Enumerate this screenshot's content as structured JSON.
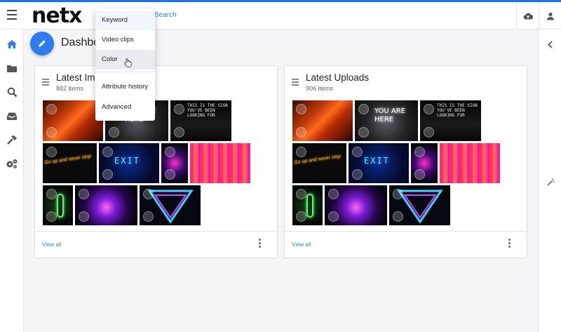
{
  "app": {
    "logo": "netx",
    "search_link": "Search"
  },
  "page": {
    "title": "Dashboard"
  },
  "menu": {
    "items": [
      "Keyword",
      "Video clips",
      "Color",
      "Attribute history",
      "Advanced"
    ],
    "hovered": "Color"
  },
  "cards": [
    {
      "title": "Latest Images",
      "count": "882 items",
      "view_all": "View all"
    },
    {
      "title": "Latest Uploads",
      "count": "906 items",
      "view_all": "View all"
    }
  ],
  "thumbs": {
    "are_here_text": "YOU ARE HERE",
    "sign_text": "THIS IS THE SIGN YOU'VE BEEN LOOKING FOR",
    "goup_text": "Go up and never stop",
    "exit_text": "EXIT"
  },
  "icons": {
    "menu": "hamburger-icon",
    "upload": "cloud-upload-icon",
    "user": "user-icon",
    "home": "home-icon",
    "folder": "folder-icon",
    "search": "search-icon",
    "inbox": "inbox-icon",
    "tools": "hammer-icon",
    "settings": "gears-icon",
    "collapse": "chevron-left-icon",
    "magic": "magic-wand-icon",
    "edit": "pencil-icon"
  },
  "colors": {
    "accent": "#2f7cf1",
    "link": "#3b82d6",
    "topbar_border": "#1a73e8"
  }
}
